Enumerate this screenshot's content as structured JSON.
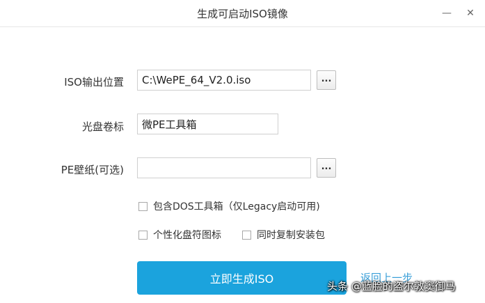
{
  "window": {
    "title": "生成可启动ISO镜像",
    "minimize_glyph": "—",
    "close_glyph": "✕"
  },
  "form": {
    "iso_path_label": "ISO输出位置",
    "iso_path_value": "C:\\WePE_64_V2.0.iso",
    "volume_label": "光盘卷标",
    "volume_value": "微PE工具箱",
    "wallpaper_label": "PE壁纸(可选)",
    "wallpaper_value": "",
    "browse_label": "..."
  },
  "options": {
    "include_dos": "包含DOS工具箱（仅Legacy启动可用)",
    "personalize_icon": "个性化盘符图标",
    "copy_installer": "同时复制安装包"
  },
  "actions": {
    "generate": "立即生成ISO",
    "back": "返回上一步"
  },
  "watermark": "头条 @蓝脸的盗尔敦窦御马",
  "colors": {
    "accent": "#1ba3dd",
    "link": "#3a9fd8"
  }
}
